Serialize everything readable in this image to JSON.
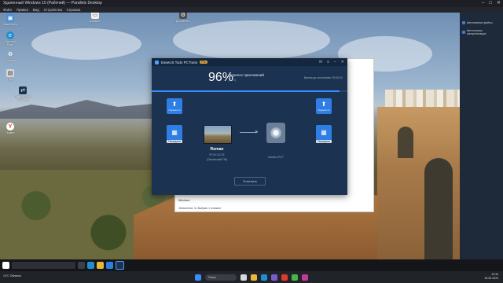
{
  "host": {
    "title": "Удаленный Windows 10 (Рабочий) — Parallels Desktop",
    "menu": [
      "Файл",
      "Правка",
      "Вид",
      "Устройства",
      "Справка"
    ]
  },
  "desktop": {
    "icons": [
      {
        "label": "Компьютер",
        "glyph": "▣"
      },
      {
        "label": "Microsoft Edge",
        "glyph": "e"
      },
      {
        "label": "Корзина",
        "glyph": "♻"
      },
      {
        "label": "Пуск",
        "glyph": "▤"
      },
      {
        "label": "EaseUS Todo PCTrans",
        "glyph": "⇄"
      },
      {
        "label": "Яндекс",
        "glyph": "Y"
      },
      {
        "label": "Документ",
        "glyph": "▭"
      },
      {
        "label": "Документы",
        "glyph": "⚙"
      }
    ]
  },
  "sidepanel": {
    "items": [
      "Автономные файлы",
      "Автономная синхронизация"
    ]
  },
  "explorer": {
    "folder": "Windows",
    "status": "Элементов: 11   Выбран 1 элемент"
  },
  "app": {
    "name": "EaseUS Todo PCTrans",
    "badge": "Pro",
    "progress_percent_text": "96%",
    "progress_fraction": 0.96,
    "progress_title": "Перенос приложений",
    "progress_subtitle": "(1 / 1)",
    "time_left": "Время до окончания: 00:00:02",
    "left_tiles": [
      {
        "icon": "⬆",
        "label": "Перенести"
      },
      {
        "icon": "▦",
        "label": "Передача"
      }
    ],
    "right_tiles": [
      {
        "icon": "⬆",
        "label": "Перенести"
      },
      {
        "icon": "▦",
        "label": "Передача"
      }
    ],
    "source": {
      "name": "Roman",
      "ip": "IP:10.0.2.15",
      "network": "(Локальный ПК)"
    },
    "destination": {
      "name": "roman-LPC7"
    },
    "cancel_label": "Отменить"
  },
  "taskbar": {
    "weather": "14°C Облачно",
    "search": "Поиск",
    "time": "10:34",
    "date": "25.05.2023"
  }
}
